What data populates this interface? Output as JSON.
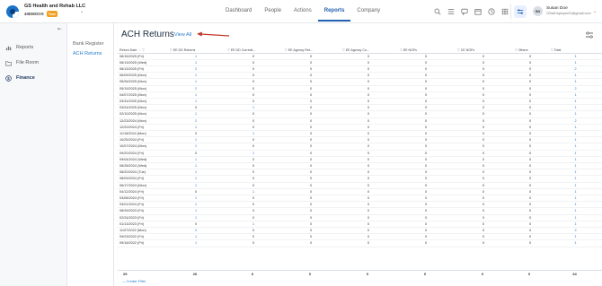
{
  "company": {
    "name": "GS Health and Rehab LLC",
    "code": "40EMOOS",
    "badge": "Test"
  },
  "nav": [
    {
      "label": "Dashboard"
    },
    {
      "label": "People"
    },
    {
      "label": "Actions"
    },
    {
      "label": "Reports"
    },
    {
      "label": "Company"
    }
  ],
  "nav_active": "Reports",
  "user": {
    "initials": "SD",
    "name": "Susan Doe",
    "email": "GSwEmployer20@gmail.com"
  },
  "sidebar": {
    "items": [
      {
        "label": "Reports",
        "icon": "reports-icon"
      },
      {
        "label": "File Room",
        "icon": "file-room-icon"
      },
      {
        "label": "Finance",
        "icon": "finance-icon"
      }
    ]
  },
  "subnav": {
    "items": [
      {
        "label": "Bank Register"
      },
      {
        "label": "ACH Returns"
      }
    ]
  },
  "page": {
    "title": "ACH Returns",
    "view_all": "View All"
  },
  "table": {
    "headers": [
      "Return Date",
      "EE DD Returns",
      "EE DD Correcti...",
      "EE Agency Ret...",
      "EE Agency Co...",
      "EE NOFs",
      "CE NOFs",
      "Others",
      "Total"
    ],
    "rows": [
      [
        "08/15/2025 (Fri)",
        "1",
        "0",
        "0",
        "0",
        "0",
        "0",
        "0",
        "1"
      ],
      [
        "08/13/2025 (Wed)",
        "1",
        "0",
        "0",
        "0",
        "0",
        "0",
        "0",
        "1"
      ],
      [
        "06/13/2025 (Fri)",
        "2",
        "0",
        "0",
        "0",
        "0",
        "0",
        "0",
        "2"
      ],
      [
        "06/09/2025 (Mon)",
        "1",
        "0",
        "0",
        "0",
        "0",
        "0",
        "0",
        "1"
      ],
      [
        "05/26/2025 (Mon)",
        "1",
        "0",
        "0",
        "0",
        "0",
        "0",
        "0",
        "1"
      ],
      [
        "05/19/2025 (Mon)",
        "2",
        "0",
        "0",
        "0",
        "0",
        "0",
        "0",
        "2"
      ],
      [
        "04/07/2025 (Mon)",
        "1",
        "0",
        "0",
        "0",
        "0",
        "0",
        "0",
        "1"
      ],
      [
        "03/31/2025 (Mon)",
        "1",
        "0",
        "0",
        "0",
        "0",
        "0",
        "0",
        "1"
      ],
      [
        "03/24/2025 (Mon)",
        "0",
        "1",
        "0",
        "0",
        "0",
        "0",
        "0",
        "1"
      ],
      [
        "02/10/2025 (Mon)",
        "1",
        "0",
        "0",
        "0",
        "0",
        "0",
        "0",
        "1"
      ],
      [
        "12/23/2024 (Mon)",
        "2",
        "0",
        "0",
        "0",
        "0",
        "0",
        "0",
        "2"
      ],
      [
        "12/20/2024 (Fri)",
        "1",
        "0",
        "0",
        "0",
        "0",
        "0",
        "0",
        "1"
      ],
      [
        "11/18/2024 (Mon)",
        "0",
        "1",
        "0",
        "0",
        "0",
        "0",
        "0",
        "1"
      ],
      [
        "10/25/2024 (Fri)",
        "1",
        "0",
        "0",
        "0",
        "0",
        "0",
        "0",
        "1"
      ],
      [
        "10/07/2024 (Mon)",
        "1",
        "0",
        "0",
        "0",
        "0",
        "0",
        "0",
        "1"
      ],
      [
        "09/20/2024 (Fri)",
        "0",
        "1",
        "0",
        "0",
        "0",
        "0",
        "0",
        "1"
      ],
      [
        "09/04/2024 (Wed)",
        "1",
        "0",
        "0",
        "0",
        "0",
        "0",
        "0",
        "1"
      ],
      [
        "08/28/2024 (Wed)",
        "1",
        "0",
        "0",
        "0",
        "0",
        "0",
        "0",
        "1"
      ],
      [
        "08/20/2024 (Tue)",
        "1",
        "0",
        "0",
        "0",
        "0",
        "0",
        "0",
        "1"
      ],
      [
        "08/09/2024 (Fri)",
        "1",
        "0",
        "0",
        "0",
        "0",
        "0",
        "0",
        "1"
      ],
      [
        "06/17/2024 (Mon)",
        "1",
        "0",
        "0",
        "0",
        "0",
        "0",
        "0",
        "1"
      ],
      [
        "04/12/2024 (Fri)",
        "0",
        "1",
        "0",
        "0",
        "0",
        "0",
        "0",
        "1"
      ],
      [
        "03/08/2024 (Fri)",
        "1",
        "0",
        "0",
        "0",
        "0",
        "0",
        "0",
        "1"
      ],
      [
        "03/01/2024 (Fri)",
        "1",
        "0",
        "0",
        "0",
        "0",
        "0",
        "0",
        "1"
      ],
      [
        "08/25/2023 (Fri)",
        "1",
        "0",
        "0",
        "0",
        "0",
        "0",
        "0",
        "1"
      ],
      [
        "02/24/2023 (Fri)",
        "1",
        "0",
        "0",
        "0",
        "0",
        "0",
        "0",
        "1"
      ],
      [
        "01/13/2023 (Fri)",
        "0",
        "1",
        "0",
        "0",
        "0",
        "0",
        "0",
        "1"
      ],
      [
        "11/07/2022 (Mon)",
        "2",
        "0",
        "0",
        "0",
        "0",
        "0",
        "0",
        "2"
      ],
      [
        "09/23/2022 (Fri)",
        "1",
        "0",
        "0",
        "0",
        "0",
        "0",
        "0",
        "1"
      ],
      [
        "09/16/2022 (Fri)",
        "1",
        "0",
        "0",
        "0",
        "0",
        "0",
        "0",
        "1"
      ]
    ],
    "totals": [
      "29",
      "26",
      "6",
      "0",
      "0",
      "0",
      "0",
      "0",
      "34"
    ]
  },
  "create_filter": "Create Filter",
  "colors": {
    "accent": "#2060b0",
    "link": "#2a7bd0",
    "badge": "#f0a020",
    "annotation": "#c0392b"
  }
}
